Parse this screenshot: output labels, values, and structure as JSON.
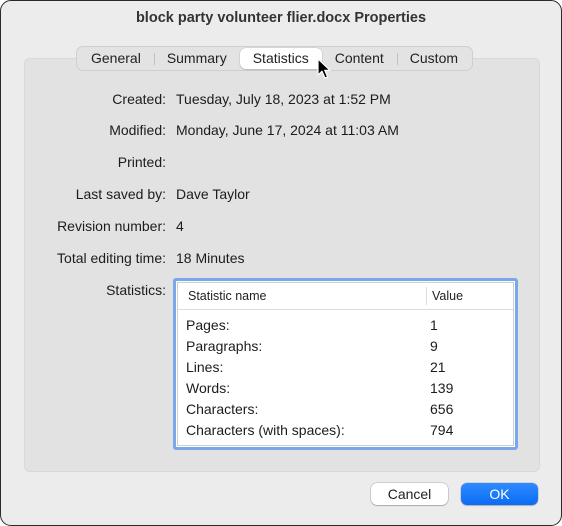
{
  "window": {
    "title": "block party volunteer flier.docx Properties"
  },
  "tabs": [
    {
      "label": "General"
    },
    {
      "label": "Summary"
    },
    {
      "label": "Statistics",
      "active": true
    },
    {
      "label": "Content"
    },
    {
      "label": "Custom"
    }
  ],
  "fields": {
    "created": {
      "label": "Created:",
      "value": "Tuesday, July 18, 2023 at 1:52 PM"
    },
    "modified": {
      "label": "Modified:",
      "value": "Monday, June 17, 2024 at 11:03 AM"
    },
    "printed": {
      "label": "Printed:",
      "value": ""
    },
    "last_saved_by": {
      "label": "Last saved by:",
      "value": "Dave Taylor"
    },
    "revision_number": {
      "label": "Revision number:",
      "value": "4"
    },
    "total_editing_time": {
      "label": "Total editing time:",
      "value": "18 Minutes"
    },
    "statistics": {
      "label": "Statistics:"
    }
  },
  "stats_table": {
    "col_name": "Statistic name",
    "col_value": "Value",
    "rows": [
      {
        "name": "Pages:",
        "value": "1"
      },
      {
        "name": "Paragraphs:",
        "value": "9"
      },
      {
        "name": "Lines:",
        "value": "21"
      },
      {
        "name": "Words:",
        "value": "139"
      },
      {
        "name": "Characters:",
        "value": "656"
      },
      {
        "name": "Characters (with spaces):",
        "value": "794"
      }
    ]
  },
  "buttons": {
    "cancel": "Cancel",
    "ok": "OK"
  },
  "colors": {
    "accent": "#0a6cf5",
    "focus_ring": "#7aa7ea",
    "window_bg": "#ececec"
  }
}
